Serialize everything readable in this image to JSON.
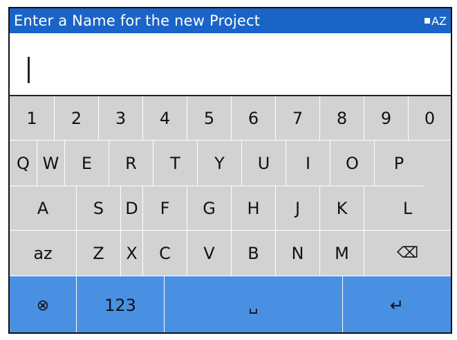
{
  "header": {
    "title": "Enter a Name for the new Project",
    "mode": "AZ"
  },
  "input": {
    "value": ""
  },
  "keyboard": {
    "digits": [
      "1",
      "2",
      "3",
      "4",
      "5",
      "6",
      "7",
      "8",
      "9",
      "0"
    ],
    "row_qwerty": [
      "Q",
      "W",
      "E",
      "R",
      "T",
      "Y",
      "U",
      "I",
      "O",
      "P"
    ],
    "row_asdf": [
      "A",
      "S",
      "D",
      "F",
      "G",
      "H",
      "J",
      "K",
      "L"
    ],
    "row_zxcv": [
      "Z",
      "X",
      "C",
      "V",
      "B",
      "N",
      "M"
    ],
    "lowercase_toggle": "az",
    "backspace_glyph": "⌫",
    "cancel_glyph": "⊗",
    "numbers_toggle": "123",
    "space_glyph": "␣",
    "enter_glyph": "↵"
  },
  "colors": {
    "title_bar": "#1a64c8",
    "key_bg": "#d2d2d2",
    "action_row": "#4a90e2"
  },
  "icons": [
    "backspace-icon",
    "cancel-icon",
    "space-icon",
    "enter-icon"
  ]
}
